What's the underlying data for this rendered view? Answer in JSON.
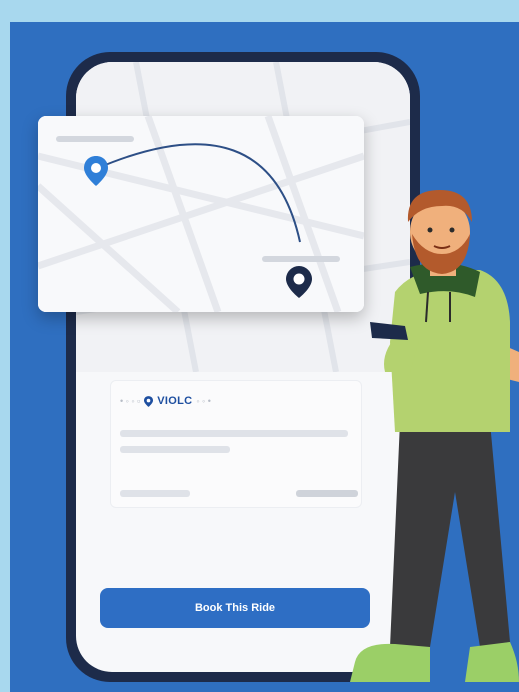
{
  "app": {
    "logo_text": "VIOLC"
  },
  "ride": {
    "book_button_label": "Book This Ride"
  },
  "colors": {
    "background": "#a8d8ee",
    "panel": "#2f6fc0",
    "accent": "#2e6ec4",
    "phone_frame": "#1d2b4a",
    "pin_blue": "#2f7fd8",
    "pin_dark": "#1d2b4a"
  },
  "icons": [
    "origin-pin-icon",
    "destination-pin-icon",
    "logo-pin-icon"
  ]
}
